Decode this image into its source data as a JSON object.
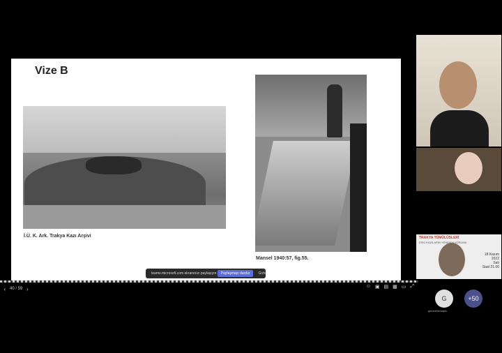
{
  "slide": {
    "title": "Vize B",
    "left_caption": "İ.Ü. K. Ark. Trakya Kazı Arşivi",
    "right_caption": "Mansel 1940:57, fig.55."
  },
  "share_bar": {
    "text": "teams.microsoft.com ekranınızı paylaşıyor.",
    "stop_label": "Paylaşmayı durdur",
    "hide_label": "Gizle"
  },
  "nav": {
    "page_indicator": "40 / 59",
    "prev_icon": "chevron-left-icon",
    "next_icon": "chevron-right-icon"
  },
  "participants": {
    "avatar_initial": "G",
    "avatar_name": "gamzekorkaplu",
    "more_count": "+50"
  },
  "poster": {
    "title": "TRAKYA TÜMÜLÜSLERİ",
    "subtitle": "ESKİ KAZILARIN YENİDEN YORUMU",
    "date_day": "18 Kasım",
    "year": "2022",
    "weekday": "Salı",
    "time": "Saat 21.00"
  },
  "colors": {
    "background": "#000000",
    "slide": "#ffffff",
    "accent": "#5b6fd6"
  }
}
